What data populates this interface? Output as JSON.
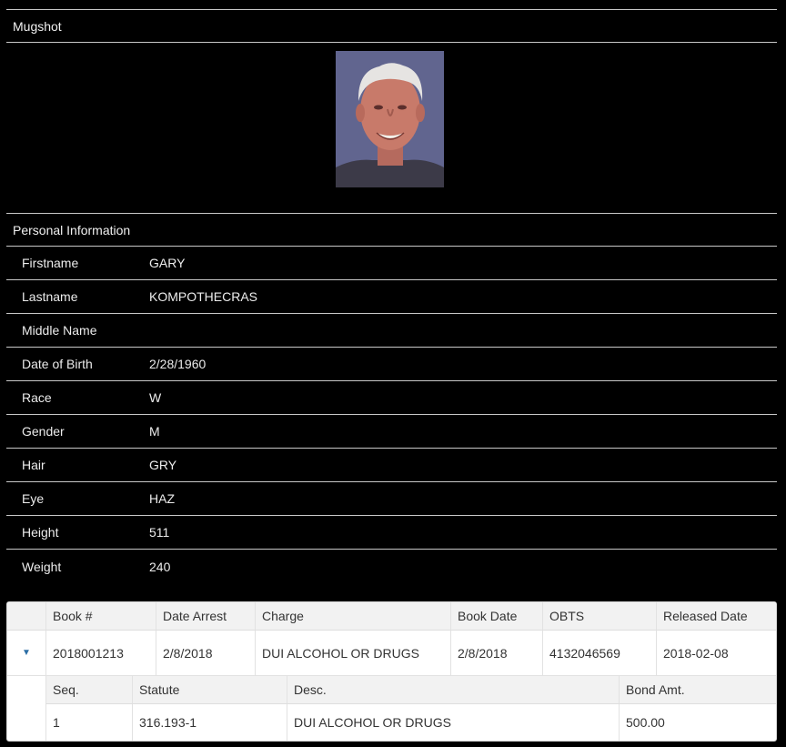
{
  "mugshot": {
    "header": "Mugshot"
  },
  "personal": {
    "header": "Personal Information",
    "rows": [
      {
        "label": "Firstname",
        "value": "GARY"
      },
      {
        "label": "Lastname",
        "value": "KOMPOTHECRAS"
      },
      {
        "label": "Middle Name",
        "value": ""
      },
      {
        "label": "Date of Birth",
        "value": "2/28/1960"
      },
      {
        "label": "Race",
        "value": "W"
      },
      {
        "label": "Gender",
        "value": "M"
      },
      {
        "label": "Hair",
        "value": "GRY"
      },
      {
        "label": "Eye",
        "value": "HAZ"
      },
      {
        "label": "Height",
        "value": "511"
      },
      {
        "label": "Weight",
        "value": "240"
      }
    ]
  },
  "bookings": {
    "columns": [
      "Book #",
      "Date Arrest",
      "Charge",
      "Book Date",
      "OBTS",
      "Released Date"
    ],
    "row": {
      "book_no": "2018001213",
      "date_arrest": "2/8/2018",
      "charge": "DUI ALCOHOL OR DRUGS",
      "book_date": "2/8/2018",
      "obts": "4132046569",
      "released_date": "2018-02-08"
    },
    "expander_icon": "triangle-down-icon",
    "accent_color": "#2b6ea5",
    "charges": {
      "columns": [
        "Seq.",
        "Statute",
        "Desc.",
        "Bond Amt."
      ],
      "row": {
        "seq": "1",
        "statute": "316.193-1",
        "desc": "DUI ALCOHOL OR DRUGS",
        "bond": "500.00"
      }
    }
  }
}
